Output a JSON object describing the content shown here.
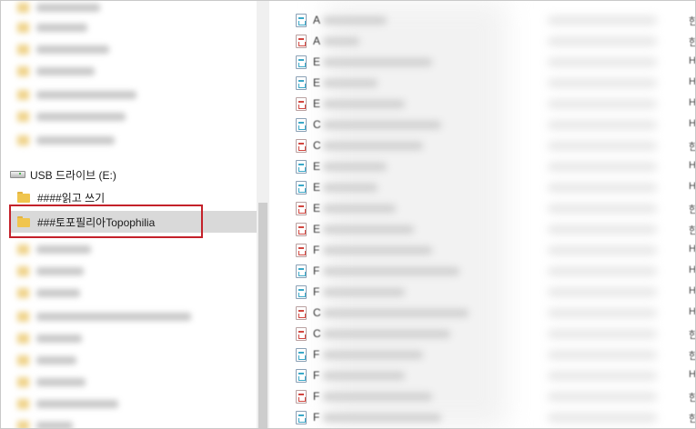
{
  "nav": {
    "drive_label": "USB 드라이브 (E:)",
    "folders": [
      {
        "label": "####읽고 쓰기"
      },
      {
        "label": "###토포필리아Topophilia",
        "selected": true
      }
    ]
  },
  "files": [
    {
      "icon": "hwp-doc-icon",
      "initial": "A",
      "type": "한"
    },
    {
      "icon": "pdf-doc-icon",
      "initial": "A",
      "type": "한"
    },
    {
      "icon": "hwp-doc-icon",
      "initial": "E",
      "type": "H"
    },
    {
      "icon": "hwp-doc-icon",
      "initial": "E",
      "type": "H"
    },
    {
      "icon": "pdf-doc-icon",
      "initial": "E",
      "type": "H"
    },
    {
      "icon": "hwp-doc-icon",
      "initial": "C",
      "type": "H"
    },
    {
      "icon": "pdf-doc-icon",
      "initial": "C",
      "type": "한"
    },
    {
      "icon": "hwp-doc-icon",
      "initial": "E",
      "type": "H"
    },
    {
      "icon": "hwp-doc-icon",
      "initial": "E",
      "type": "H"
    },
    {
      "icon": "pdf-doc-icon",
      "initial": "E",
      "type": "한"
    },
    {
      "icon": "pdf-doc-icon",
      "initial": "E",
      "type": "한"
    },
    {
      "icon": "pdf-doc-icon",
      "initial": "F",
      "type": "H"
    },
    {
      "icon": "hwp-doc-icon",
      "initial": "F",
      "type": "H"
    },
    {
      "icon": "hwp-doc-icon",
      "initial": "F",
      "type": "H"
    },
    {
      "icon": "pdf-doc-icon",
      "initial": "C",
      "type": "H"
    },
    {
      "icon": "pdf-doc-icon",
      "initial": "C",
      "type": "한"
    },
    {
      "icon": "hwp-doc-icon",
      "initial": "F",
      "type": "한"
    },
    {
      "icon": "hwp-doc-icon",
      "initial": "F",
      "type": "H"
    },
    {
      "icon": "pdf-doc-icon",
      "initial": "F",
      "type": "한"
    },
    {
      "icon": "hwp-doc-icon",
      "initial": "F",
      "type": "한"
    },
    {
      "icon": "hwp-doc-icon",
      "initial": "I",
      "type": "H"
    }
  ],
  "colors": {
    "selection": "#d9d9d9",
    "highlight_border": "#c4212a",
    "folder": "#f0c54e"
  }
}
